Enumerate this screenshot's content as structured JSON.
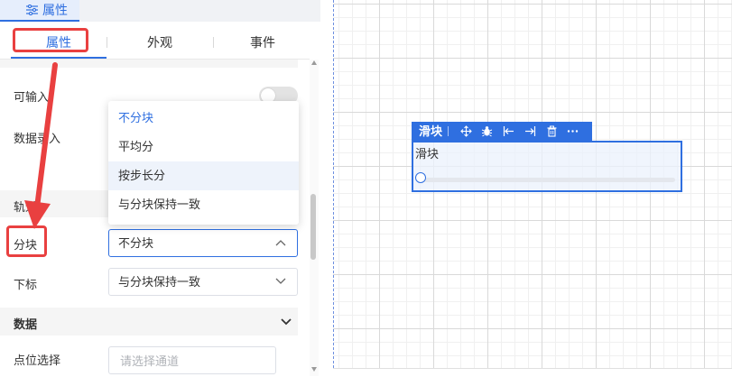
{
  "panel": {
    "tab_label": "属性",
    "subtabs": {
      "props": "属性",
      "appearance": "外观",
      "events": "事件"
    }
  },
  "fields": {
    "inputable_label": "可输入",
    "data_entry_label": "数据录入",
    "track_section": "轨道",
    "fenkuai_label": "分块",
    "fenkuai_value": "不分块",
    "xiabiao_label": "下标",
    "xiabiao_value": "与分块保持一致",
    "data_section": "数据",
    "point_label": "点位选择",
    "channel_placeholder": "请选择通道"
  },
  "dropdown": {
    "options": [
      "不分块",
      "平均分",
      "按步长分",
      "与分块保持一致"
    ],
    "selected": "不分块",
    "hovered": "按步长分"
  },
  "canvas": {
    "widget_name": "滑块",
    "widget_label": "滑块",
    "toolbar_icons": [
      "move-icon",
      "bug-icon",
      "align-left-icon",
      "align-right-icon",
      "trash-icon",
      "more-icon"
    ]
  },
  "colors": {
    "accent": "#2f6fe0",
    "annotation": "#e94040"
  }
}
